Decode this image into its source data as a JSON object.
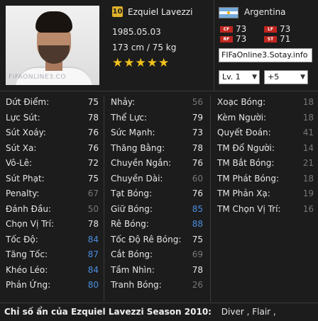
{
  "player": {
    "number": "10",
    "name": "Ezquiel Lavezzi",
    "dob": "1985.05.03",
    "height_weight": "173 cm / 75 kg",
    "stars": "★★★★★",
    "country": "Argentina",
    "photo_watermark": "FIFAONLINE3.CO"
  },
  "positions": [
    {
      "tag": "CF",
      "value": "73"
    },
    {
      "tag": "LF",
      "value": "73"
    },
    {
      "tag": "RF",
      "value": "73"
    },
    {
      "tag": "ST",
      "value": "71"
    }
  ],
  "site_label": "FIFaOnline3.Sotay.info",
  "selects": {
    "level": "Lv. 1",
    "plus": "+5"
  },
  "colors": {
    "white": "#e8e8e8",
    "grey": "#777777",
    "blue": "#4a8ee0",
    "star": "#f2c21b",
    "pos_tag": "#c0261f"
  },
  "stats": {
    "col1": [
      {
        "label": "Dứt Điểm:",
        "value": "75",
        "color": "#e8e8e8"
      },
      {
        "label": "Lực Sút:",
        "value": "78",
        "color": "#e8e8e8"
      },
      {
        "label": "Sút Xoáy:",
        "value": "76",
        "color": "#e8e8e8"
      },
      {
        "label": "Sút Xa:",
        "value": "76",
        "color": "#e8e8e8"
      },
      {
        "label": "Vô-Lê:",
        "value": "72",
        "color": "#e8e8e8"
      },
      {
        "label": "Sút Phạt:",
        "value": "75",
        "color": "#e8e8e8"
      },
      {
        "label": "Penalty:",
        "value": "67",
        "color": "#777777"
      },
      {
        "label": "Đánh Đầu:",
        "value": "50",
        "color": "#777777"
      },
      {
        "label": "Chọn Vị Trí:",
        "value": "78",
        "color": "#e8e8e8"
      },
      {
        "label": "Tốc Độ:",
        "value": "84",
        "color": "#4a8ee0"
      },
      {
        "label": "Tăng Tốc:",
        "value": "87",
        "color": "#4a8ee0"
      },
      {
        "label": "Khéo Léo:",
        "value": "84",
        "color": "#4a8ee0"
      },
      {
        "label": "Phản Ứng:",
        "value": "80",
        "color": "#4a8ee0"
      }
    ],
    "col2": [
      {
        "label": "Nhảy:",
        "value": "56",
        "color": "#777777"
      },
      {
        "label": "Thể Lực:",
        "value": "79",
        "color": "#e8e8e8"
      },
      {
        "label": "Sức Mạnh:",
        "value": "73",
        "color": "#e8e8e8"
      },
      {
        "label": "Thăng Bằng:",
        "value": "78",
        "color": "#e8e8e8"
      },
      {
        "label": "Chuyền Ngắn:",
        "value": "76",
        "color": "#e8e8e8"
      },
      {
        "label": "Chuyền Dài:",
        "value": "60",
        "color": "#777777"
      },
      {
        "label": "Tạt Bóng:",
        "value": "76",
        "color": "#e8e8e8"
      },
      {
        "label": "Giữ Bóng:",
        "value": "85",
        "color": "#4a8ee0"
      },
      {
        "label": "Rê Bóng:",
        "value": "88",
        "color": "#4a8ee0"
      },
      {
        "label": "Tốc Độ Rê Bóng:",
        "value": "75",
        "color": "#e8e8e8"
      },
      {
        "label": "Cắt Bóng:",
        "value": "69",
        "color": "#777777"
      },
      {
        "label": "Tầm Nhìn:",
        "value": "78",
        "color": "#e8e8e8"
      },
      {
        "label": "Tranh Bóng:",
        "value": "26",
        "color": "#777777"
      }
    ],
    "col3": [
      {
        "label": "Xoạc Bóng:",
        "value": "18",
        "color": "#777777"
      },
      {
        "label": "Kèm Người:",
        "value": "18",
        "color": "#777777"
      },
      {
        "label": "Quyết Đoán:",
        "value": "41",
        "color": "#777777"
      },
      {
        "label": "TM Đổ Người:",
        "value": "14",
        "color": "#777777"
      },
      {
        "label": "TM Bắt Bóng:",
        "value": "21",
        "color": "#777777"
      },
      {
        "label": "TM Phát Bóng:",
        "value": "18",
        "color": "#777777"
      },
      {
        "label": "TM Phản Xạ:",
        "value": "19",
        "color": "#777777"
      },
      {
        "label": "TM Chọn Vị Trí:",
        "value": "16",
        "color": "#777777"
      }
    ]
  },
  "footer": {
    "title": "Chỉ số ẩn của Ezquiel Lavezzi Season 2010:",
    "traits": "Diver , Flair ,"
  }
}
